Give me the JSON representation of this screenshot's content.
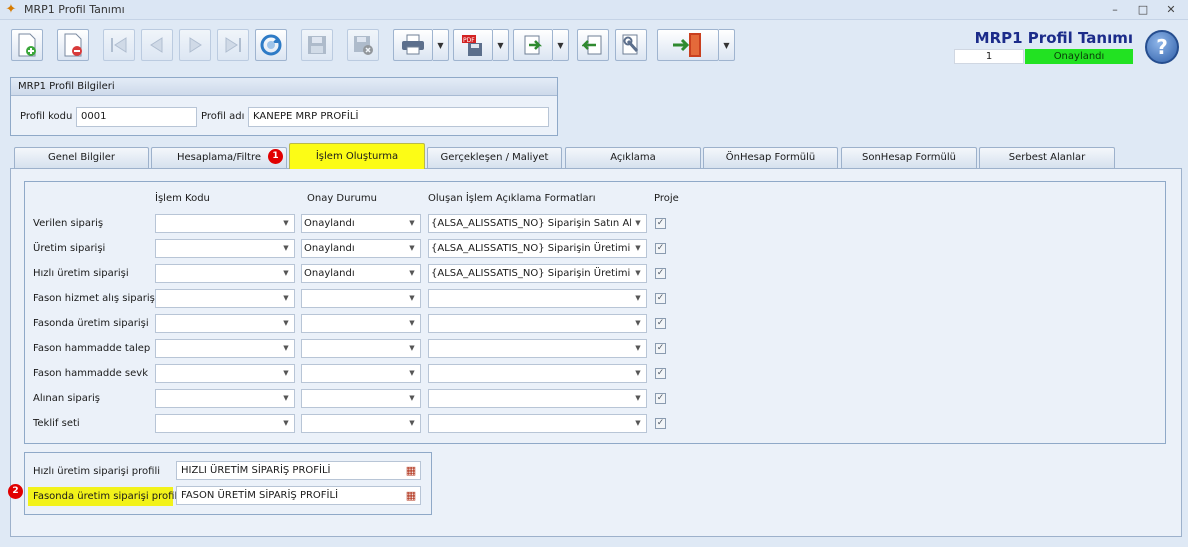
{
  "window": {
    "title": "MRP1 Profil Tanımı",
    "controls": [
      "–",
      "□",
      "✕"
    ]
  },
  "header": {
    "title": "MRP1 Profil Tanımı",
    "record_no": "1",
    "status": "Onaylandı",
    "status_color": "#22e222",
    "help": "?"
  },
  "toolbar": {
    "buttons": [
      "new-document-icon",
      "delete-document-icon",
      "first-record-icon",
      "previous-record-icon",
      "next-record-icon",
      "last-record-icon",
      "refresh-icon",
      "save-icon",
      "cancel-save-icon",
      "print-icon",
      "pdf-export-icon",
      "export-icon",
      "import-icon",
      "settings-wrench-icon",
      "exit-door-icon"
    ]
  },
  "profile_info": {
    "title": "MRP1 Profil Bilgileri",
    "code_label": "Profil kodu",
    "code_value": "0001",
    "name_label": "Profil adı",
    "name_value": "KANEPE MRP PROFİLİ"
  },
  "tabs": [
    {
      "label": "Genel Bilgiler"
    },
    {
      "label": "Hesaplama/Filtre"
    },
    {
      "label": "İşlem Oluşturma"
    },
    {
      "label": "Gerçekleşen / Maliyet"
    },
    {
      "label": "Açıklama"
    },
    {
      "label": "ÖnHesap Formülü"
    },
    {
      "label": "SonHesap Formülü"
    },
    {
      "label": "Serbest Alanlar"
    }
  ],
  "badges": {
    "tab": "1",
    "field": "2"
  },
  "grid": {
    "headers": {
      "islem_kodu": "İşlem Kodu",
      "onay_durumu": "Onay Durumu",
      "aciklama_format": "Oluşan İşlem Açıklama Formatları",
      "proje": "Proje"
    },
    "rows": [
      {
        "label": "Verilen sipariş",
        "islem_kodu": "",
        "onay": "Onaylandı",
        "format": "{ALSA_ALISSATIS_NO} Siparişin Satın Alm",
        "proje": true
      },
      {
        "label": "Üretim siparişi",
        "islem_kodu": "",
        "onay": "Onaylandı",
        "format": "{ALSA_ALISSATIS_NO} Siparişin Üretimi",
        "proje": true
      },
      {
        "label": "Hızlı üretim siparişi",
        "islem_kodu": "",
        "onay": "Onaylandı",
        "format": "{ALSA_ALISSATIS_NO} Siparişin Üretimi",
        "proje": true
      },
      {
        "label": "Fason hizmet alış siparişi",
        "islem_kodu": "",
        "onay": "",
        "format": "",
        "proje": true
      },
      {
        "label": "Fasonda üretim siparişi",
        "islem_kodu": "",
        "onay": "",
        "format": "",
        "proje": true
      },
      {
        "label": "Fason hammadde talep",
        "islem_kodu": "",
        "onay": "",
        "format": "",
        "proje": true
      },
      {
        "label": "Fason hammadde sevk",
        "islem_kodu": "",
        "onay": "",
        "format": "",
        "proje": true
      },
      {
        "label": "Alınan sipariş",
        "islem_kodu": "",
        "onay": "",
        "format": "",
        "proje": true
      },
      {
        "label": "Teklif seti",
        "islem_kodu": "",
        "onay": "",
        "format": "",
        "proje": true
      }
    ]
  },
  "profiles": {
    "fast_label": "Hızlı üretim siparişi profili",
    "fast_value": "HIZLI ÜRETİM SİPARİŞ PROFİLİ",
    "fason_label": "Fasonda üretim siparişi profili",
    "fason_value": "FASON ÜRETİM SİPARİŞ PROFİLİ",
    "highlight_color": "#f2f21a"
  }
}
